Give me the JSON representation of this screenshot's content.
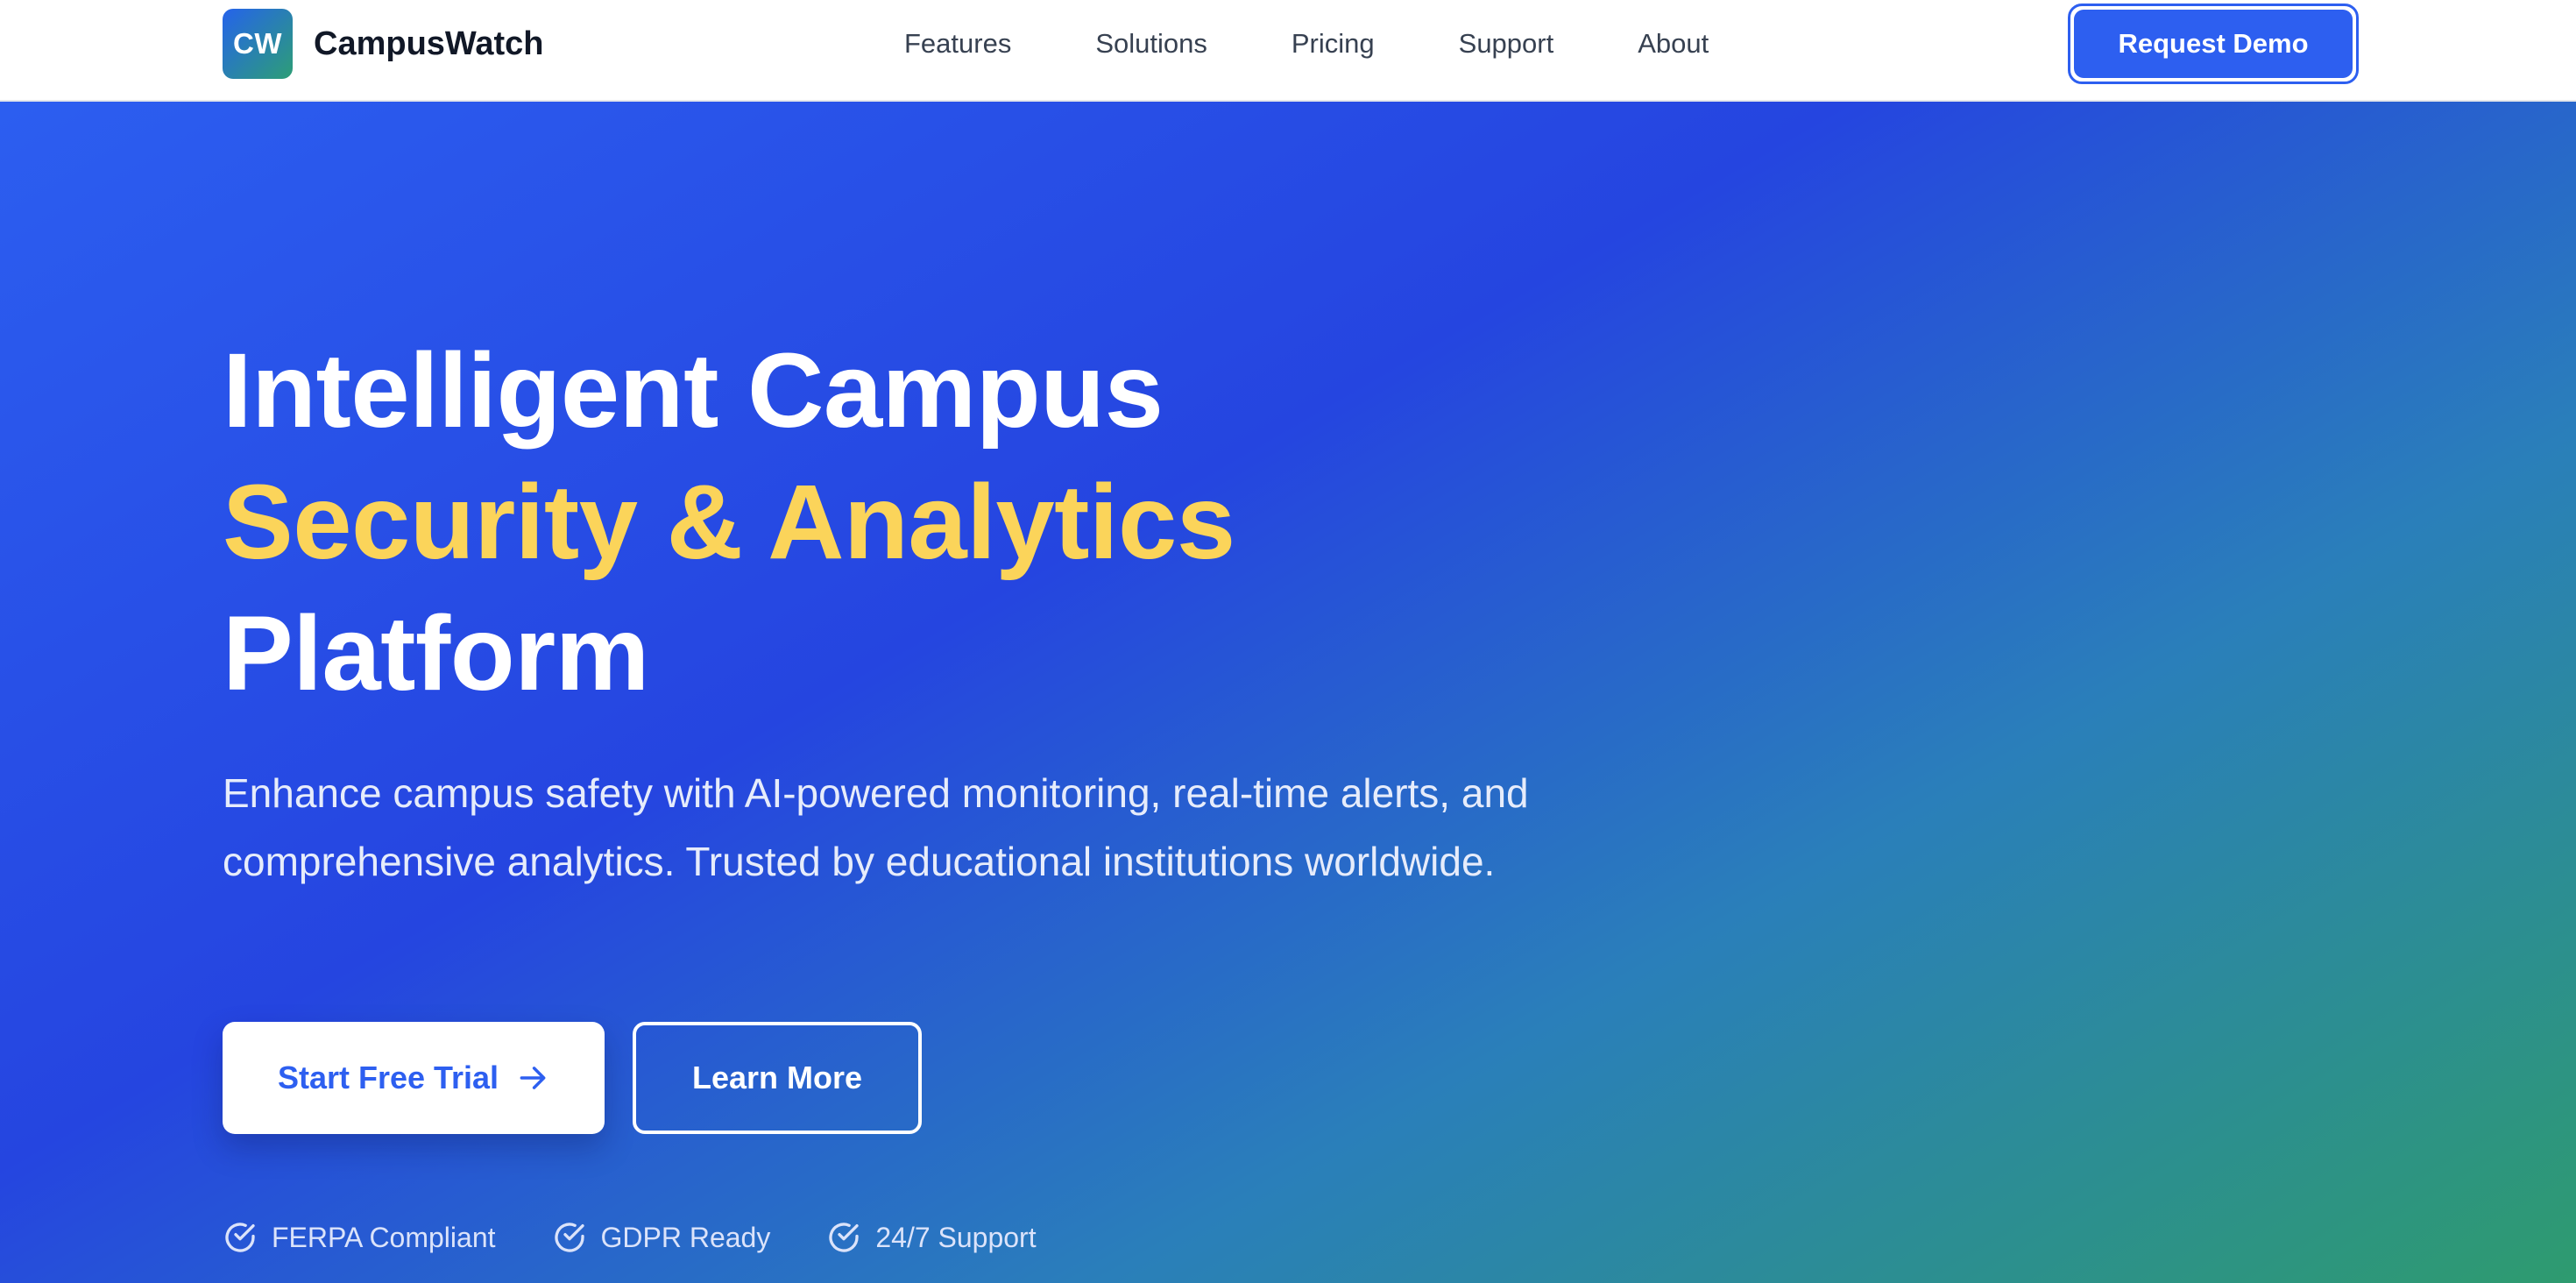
{
  "brand": {
    "logo_text": "CW",
    "name": "CampusWatch"
  },
  "nav": {
    "items": [
      {
        "label": "Features"
      },
      {
        "label": "Solutions"
      },
      {
        "label": "Pricing"
      },
      {
        "label": "Support"
      },
      {
        "label": "About"
      }
    ],
    "cta_label": "Request Demo"
  },
  "hero": {
    "headline_line1": "Intelligent Campus",
    "headline_line2": "Security & Analytics",
    "headline_line3": "Platform",
    "description": "Enhance campus safety with AI-powered monitoring, real-time alerts, and comprehensive analytics. Trusted by educational institutions worldwide.",
    "primary_button": "Start Free Trial",
    "secondary_button": "Learn More",
    "badges": [
      {
        "label": "FERPA Compliant",
        "icon": "check-circle-icon"
      },
      {
        "label": "GDPR Ready",
        "icon": "check-circle-icon"
      },
      {
        "label": "24/7 Support",
        "icon": "check-circle-icon"
      }
    ]
  },
  "colors": {
    "accent": "#2d5ff0",
    "headline_highlight": "#fbd45a",
    "gradient_start": "#2c5ef0",
    "gradient_end": "#2e9b6f"
  }
}
